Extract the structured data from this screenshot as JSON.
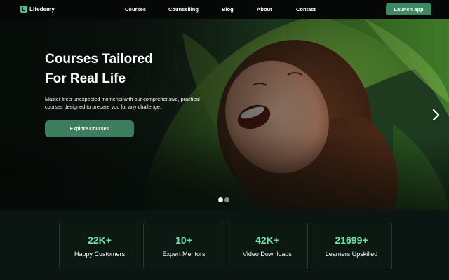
{
  "brand": {
    "name": "Lifedemy",
    "icon": "logo-icon"
  },
  "nav": {
    "items": [
      "Courses",
      "Counselling",
      "Blog",
      "About",
      "Contact"
    ],
    "cta_label": "Launch app"
  },
  "hero": {
    "title_line1": "Courses Tailored",
    "title_line2": "For Real Life",
    "subtitle": "Master life's unexpected moments with our comprehensive, practical courses designed to prepare you for any challenge.",
    "button_label": "Explore Courses",
    "next_icon": "chevron-right-icon",
    "slides_total": 2,
    "active_slide": 1
  },
  "stats": [
    {
      "value": "22K+",
      "label": "Happy Customers"
    },
    {
      "value": "10+",
      "label": "Expert Mentors"
    },
    {
      "value": "42K+",
      "label": "Video Downloads"
    },
    {
      "value": "21699+",
      "label": "Learners Upskilled"
    }
  ],
  "colors": {
    "accent": "#3d8a62",
    "stat_value": "#6fe0a8",
    "background": "#0b1511"
  }
}
